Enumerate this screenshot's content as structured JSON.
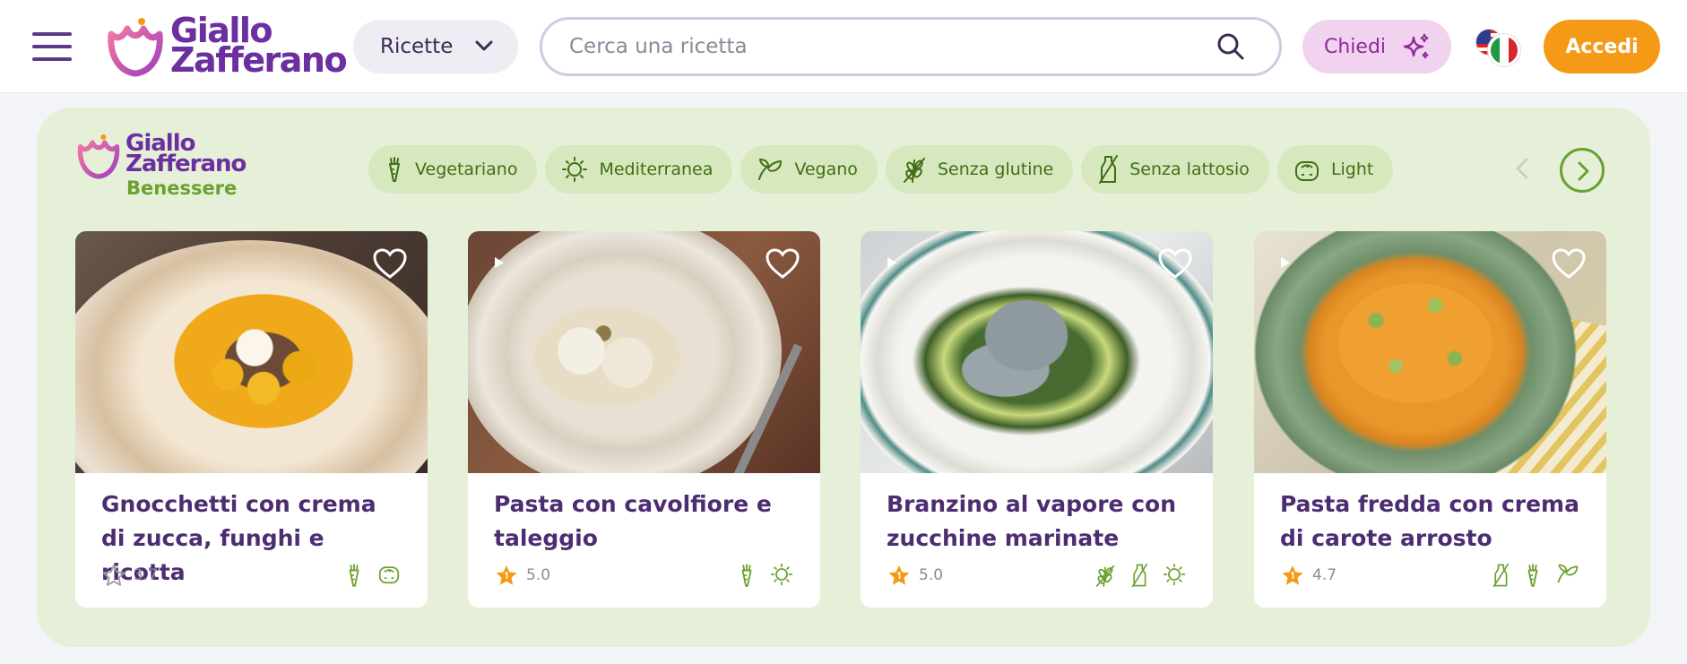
{
  "header": {
    "logo_line1": "Giallo",
    "logo_line2": "Zafferano",
    "ricette_label": "Ricette",
    "search_placeholder": "Cerca una ricetta",
    "chiedi_label": "Chiedi",
    "accedi_label": "Accedi"
  },
  "benessere": {
    "logo_line1": "Giallo",
    "logo_line2": "Zafferano",
    "logo_line3": "Benessere",
    "chips": [
      {
        "label": "Vegetariano",
        "icon": "carrot-icon"
      },
      {
        "label": "Mediterranea",
        "icon": "sun-icon"
      },
      {
        "label": "Vegano",
        "icon": "leaf-icon"
      },
      {
        "label": "Senza glutine",
        "icon": "wheat-icon"
      },
      {
        "label": "Senza lattosio",
        "icon": "milk-bottle-icon"
      },
      {
        "label": "Light",
        "icon": "scale-icon"
      }
    ],
    "cards": [
      {
        "title": "Gnocchetti con crema di zucca, funghi e ricotta",
        "rating": "3.7",
        "icons": [
          "carrot-icon",
          "scale-icon"
        ]
      },
      {
        "title": "Pasta con cavolfiore e taleggio",
        "rating": "5.0",
        "icons": [
          "carrot-icon",
          "sun-icon"
        ]
      },
      {
        "title": "Branzino al vapore con zucchine marinate",
        "rating": "5.0",
        "icons": [
          "wheat-icon",
          "milk-bottle-icon",
          "sun-icon"
        ]
      },
      {
        "title": "Pasta fredda con crema di carote arrosto",
        "rating": "4.7",
        "icons": [
          "milk-bottle-icon",
          "carrot-icon",
          "leaf-icon"
        ]
      }
    ]
  },
  "colors": {
    "brand_purple": "#6b2fa0",
    "benessere_green": "#6aa12f",
    "accedi_orange": "#f59a16",
    "chip_bg": "#d7e8bf",
    "panel_bg": "#e6f0d8"
  }
}
